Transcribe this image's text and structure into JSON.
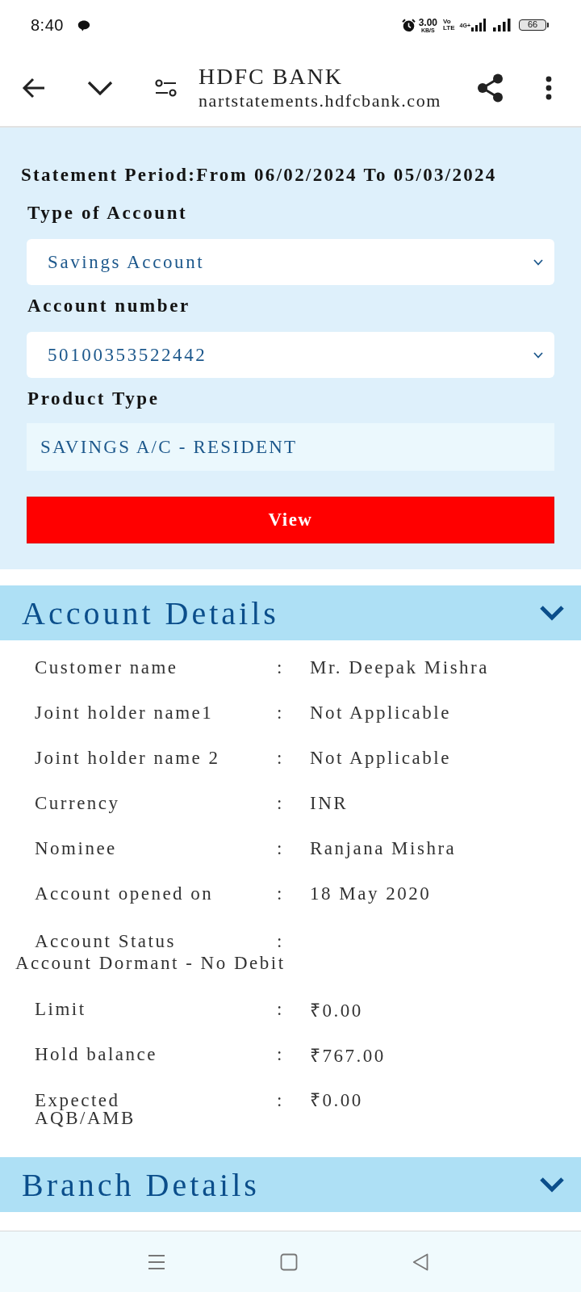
{
  "status_bar": {
    "time": "8:40",
    "net_speed": "3.00",
    "net_speed_unit": "KB/S",
    "volte": [
      "Vo",
      "LTE"
    ],
    "network": "4G+",
    "battery": "66"
  },
  "toolbar": {
    "title": "HDFC BANK",
    "url": "nartstatements.hdfcbank.com"
  },
  "statement": {
    "period": "Statement Period:From 06/02/2024 To 05/03/2024",
    "fields": [
      {
        "kind": "select",
        "label": "Type of Account",
        "value": "Savings Account"
      },
      {
        "kind": "select",
        "label": "Account number",
        "value": "50100353522442"
      },
      {
        "kind": "readonly",
        "label": "Product Type",
        "value": "SAVINGS A/C - RESIDENT"
      }
    ],
    "button": "View"
  },
  "sections": [
    {
      "title": "Account Details",
      "rows": [
        {
          "kind": "inline",
          "label": "Customer name",
          "separator": ":",
          "value": "Mr. Deepak Mishra"
        },
        {
          "kind": "inline",
          "label": "Joint holder name1",
          "separator": ":",
          "value": "Not Applicable"
        },
        {
          "kind": "inline",
          "label": "Joint holder name 2",
          "separator": ":",
          "value": "Not Applicable"
        },
        {
          "kind": "inline",
          "label": "Currency",
          "separator": ":",
          "value": "INR"
        },
        {
          "kind": "inline",
          "label": "Nominee",
          "separator": ":",
          "value": "Ranjana Mishra"
        },
        {
          "kind": "inline",
          "label": "Account opened on",
          "separator": ":",
          "value": "18 May 2020"
        },
        {
          "kind": "value_below",
          "label": "Account Status",
          "separator": ":",
          "value": "Account Dormant - No Debit"
        },
        {
          "kind": "inline",
          "label": "Limit",
          "separator": ":",
          "value": "₹0.00"
        },
        {
          "kind": "inline",
          "label": "Hold balance",
          "separator": ":",
          "value": "₹767.00"
        },
        {
          "kind": "wrapped_label",
          "label": "Expected AQB/AMB",
          "separator": ":",
          "value": "₹0.00"
        }
      ]
    },
    {
      "title": "Branch Details"
    }
  ]
}
